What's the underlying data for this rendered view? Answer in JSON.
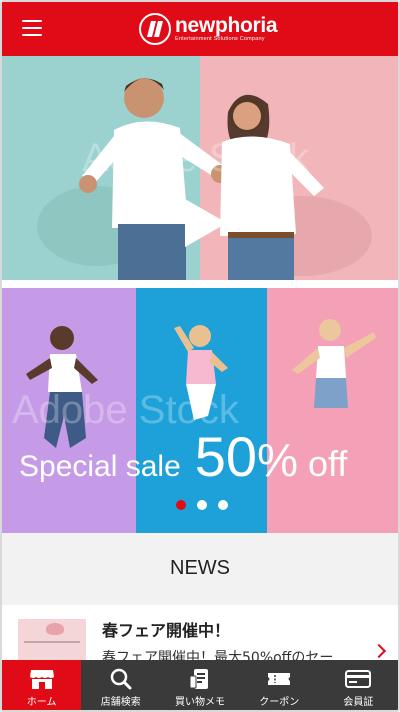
{
  "app": {
    "brand_name": "newphoria",
    "brand_tagline": "Entertainment Solutions Company"
  },
  "colors": {
    "accent": "#e10a17",
    "tabbar_bg": "#3a3a3a",
    "news_header_bg": "#f2f2f2"
  },
  "header": {
    "menu_icon": "hamburger-menu-icon",
    "logo_icon": "newphoria-logo-icon"
  },
  "hero": {
    "play_icon": "play-icon",
    "watermark": "Adobe Stock"
  },
  "banner": {
    "sale_lead": "Special sale",
    "sale_big": "50",
    "sale_pct": "%",
    "sale_off": "off",
    "watermark": "Adobe Stock",
    "slides_total": 3,
    "active_slide": 1
  },
  "news": {
    "title": "NEWS",
    "items": [
      {
        "title": "春フェア開催中！",
        "description": "春フェア開催中！最大50%offのセー",
        "icon": "chevron-right-icon"
      }
    ]
  },
  "tabbar": {
    "tabs": [
      {
        "label": "ホーム",
        "icon": "home-store-icon",
        "active": true
      },
      {
        "label": "店舗検索",
        "icon": "search-icon",
        "active": false
      },
      {
        "label": "買い物メモ",
        "icon": "shopping-memo-icon",
        "active": false
      },
      {
        "label": "クーポン",
        "icon": "coupon-ticket-icon",
        "active": false
      },
      {
        "label": "会員証",
        "icon": "member-card-icon",
        "active": false
      }
    ]
  }
}
